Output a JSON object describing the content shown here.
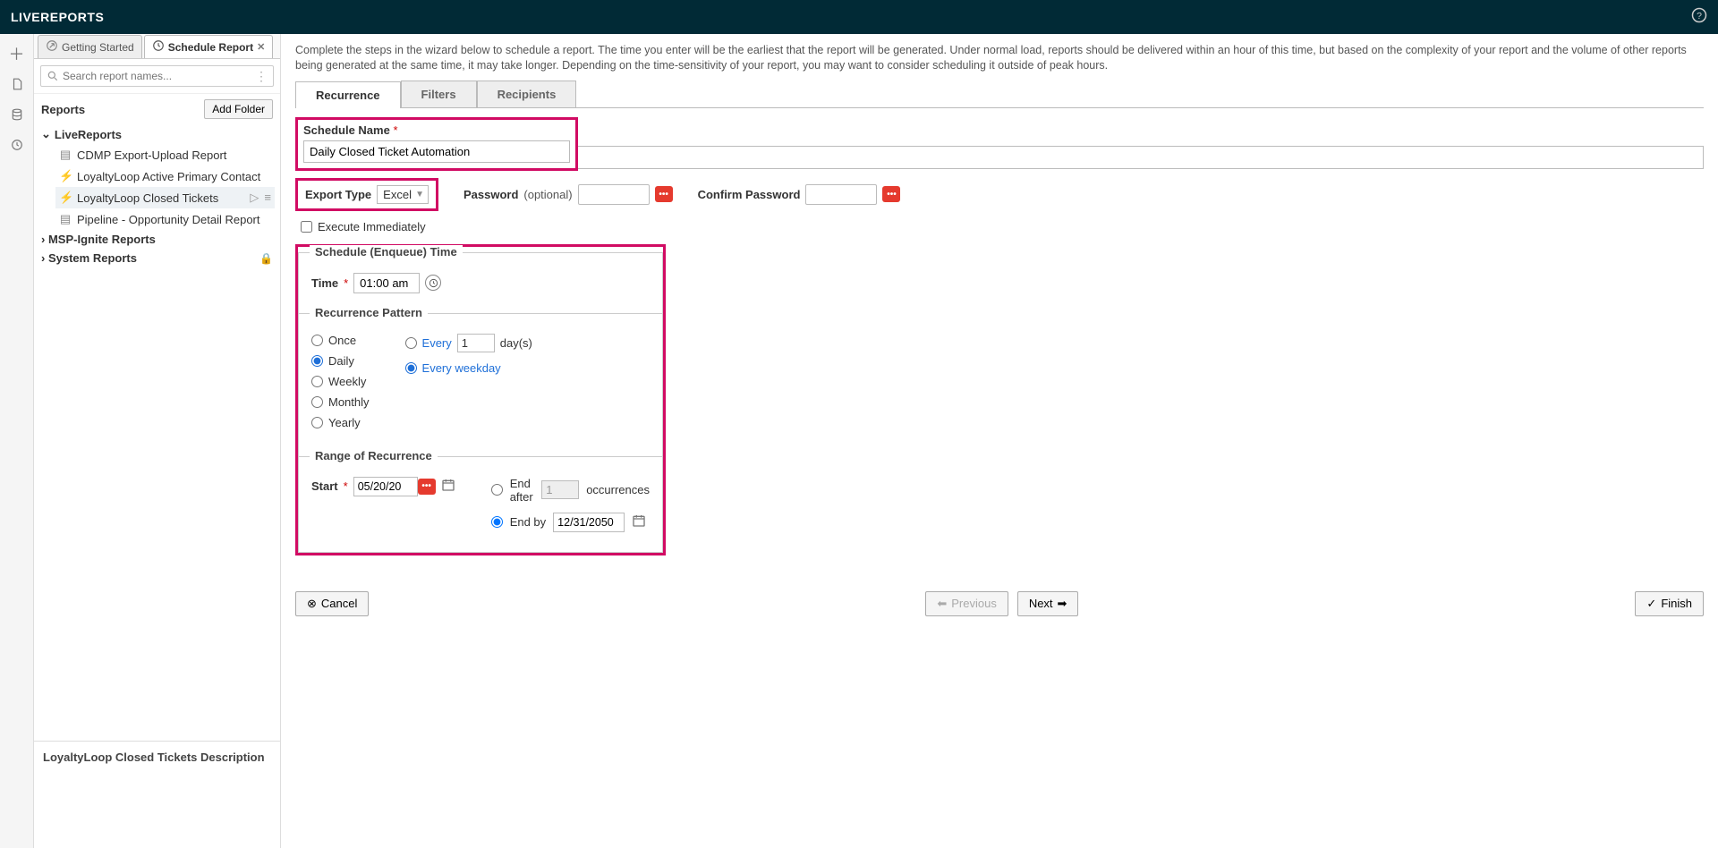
{
  "brand": "LIVEREPORTS",
  "tabs": {
    "getting_started": "Getting Started",
    "schedule_report": "Schedule Report"
  },
  "search_placeholder": "Search report names...",
  "reports_label": "Reports",
  "add_folder": "Add Folder",
  "tree": {
    "live_reports": "LiveReports",
    "items": [
      "CDMP Export-Upload Report",
      "LoyaltyLoop Active Primary Contact",
      "LoyaltyLoop Closed Tickets",
      "Pipeline - Opportunity Detail Report"
    ],
    "msp": "MSP-Ignite Reports",
    "system": "System Reports"
  },
  "description_title": "LoyaltyLoop Closed Tickets Description",
  "intro": "Complete the steps in the wizard below to schedule a report. The time you enter will be the earliest that the report will be generated. Under normal load, reports should be delivered within an hour of this time, but based on the complexity of your report and the volume of other reports being generated at the same time, it may take longer. Depending on the time-sensitivity of your report, you may want to consider scheduling it outside of peak hours.",
  "wizard_tabs": {
    "recurrence": "Recurrence",
    "filters": "Filters",
    "recipients": "Recipients"
  },
  "form": {
    "schedule_name_label": "Schedule Name",
    "schedule_name_value": "Daily Closed Ticket Automation",
    "export_type_label": "Export Type",
    "export_type_value": "Excel",
    "password_label": "Password",
    "optional": "(optional)",
    "confirm_password_label": "Confirm Password",
    "execute_immediately": "Execute Immediately",
    "schedule_time_legend": "Schedule (Enqueue) Time",
    "time_label": "Time",
    "time_value": "01:00 am",
    "recurrence_legend": "Recurrence Pattern",
    "patterns": {
      "once": "Once",
      "daily": "Daily",
      "weekly": "Weekly",
      "monthly": "Monthly",
      "yearly": "Yearly"
    },
    "every_label": "Every",
    "every_value": "1",
    "days_label": "day(s)",
    "every_weekday": "Every weekday",
    "range_legend": "Range of Recurrence",
    "start_label": "Start",
    "start_value": "05/20/20",
    "end_after": "End after",
    "occurrences_value": "1",
    "occurrences_label": "occurrences",
    "end_by": "End by",
    "end_by_value": "12/31/2050"
  },
  "buttons": {
    "cancel": "Cancel",
    "previous": "Previous",
    "next": "Next",
    "finish": "Finish"
  }
}
